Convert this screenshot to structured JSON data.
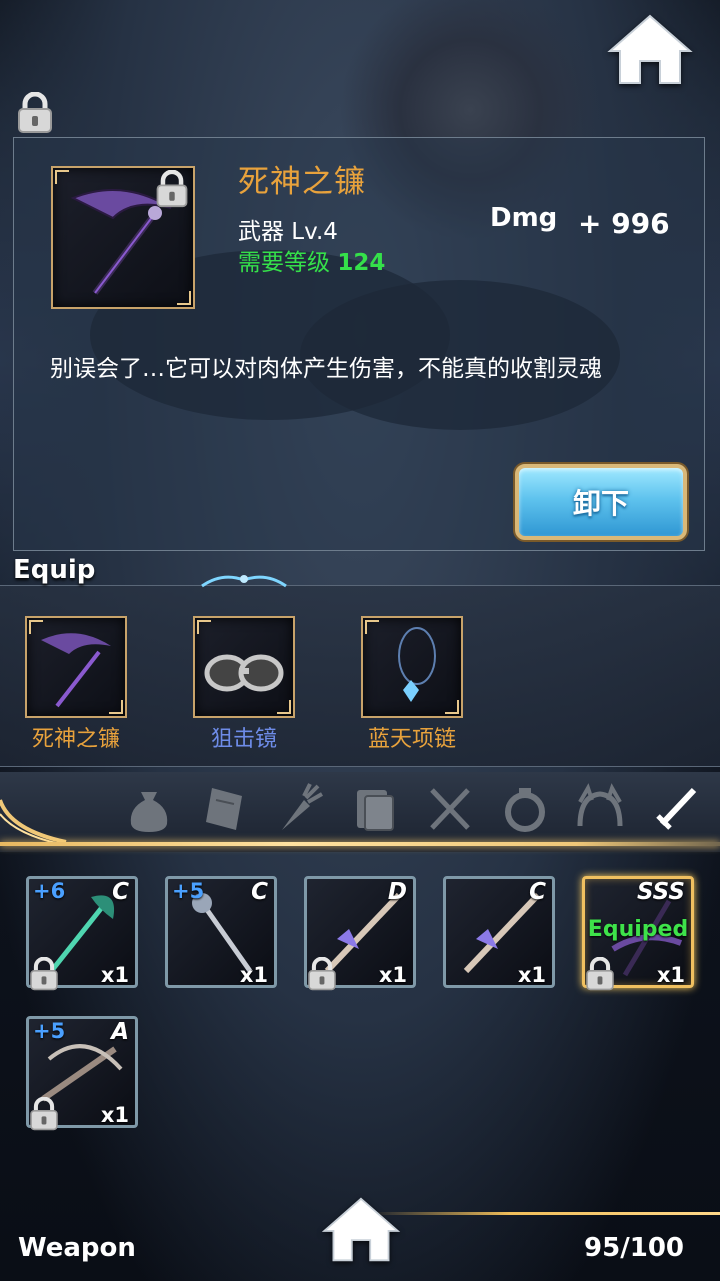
{
  "selected_item": {
    "name": "死神之镰",
    "type_label": "武器 Lv.4",
    "required_level_label": "需要等级",
    "required_level": "124",
    "stat_label": "Dmg",
    "stat_value": "+ 996",
    "description": "别误会了…它可以对肉体产生伤害，不能真的收割灵魂",
    "unequip_label": "卸下",
    "locked": true
  },
  "equip": {
    "title": "Equip",
    "slots": [
      {
        "name": "死神之镰",
        "color": "#e8a23c",
        "icon": "scythe-icon"
      },
      {
        "name": "狙击镜",
        "color": "#6e8ce8",
        "icon": "goggles-icon"
      },
      {
        "name": "蓝天项链",
        "color": "#e8a23c",
        "icon": "necklace-icon"
      }
    ]
  },
  "category_tabs": [
    {
      "icon": "bag-icon",
      "active": false
    },
    {
      "icon": "scroll-icon",
      "active": false
    },
    {
      "icon": "carrot-icon",
      "active": false
    },
    {
      "icon": "book-icon",
      "active": false
    },
    {
      "icon": "cutlery-icon",
      "active": false
    },
    {
      "icon": "ring-icon",
      "active": false
    },
    {
      "icon": "headband-icon",
      "active": false
    },
    {
      "icon": "sword-icon",
      "active": true
    }
  ],
  "inventory": [
    {
      "plus": "+6",
      "grade": "C",
      "qty": "x1",
      "locked": true,
      "equipped": false,
      "icon": "jade-staff-icon"
    },
    {
      "plus": "+5",
      "grade": "C",
      "qty": "x1",
      "locked": false,
      "equipped": false,
      "icon": "silver-staff-icon"
    },
    {
      "plus": "",
      "grade": "D",
      "qty": "x1",
      "locked": true,
      "equipped": false,
      "icon": "lance-icon"
    },
    {
      "plus": "",
      "grade": "C",
      "qty": "x1",
      "locked": false,
      "equipped": false,
      "icon": "lance-icon"
    },
    {
      "plus": "",
      "grade": "SSS",
      "qty": "x1",
      "locked": true,
      "equipped": true,
      "equipped_label": "Equiped",
      "icon": "scythe-icon"
    },
    {
      "plus": "+5",
      "grade": "A",
      "qty": "x1",
      "locked": true,
      "equipped": false,
      "icon": "crossbow-icon"
    }
  ],
  "footer": {
    "title": "Weapon",
    "count": "95/100"
  },
  "colors": {
    "item_name": "#e8a23c",
    "level_green": "#35e04a",
    "plus_blue": "#4aa0ff",
    "frame_gold": "#c8a36a"
  }
}
